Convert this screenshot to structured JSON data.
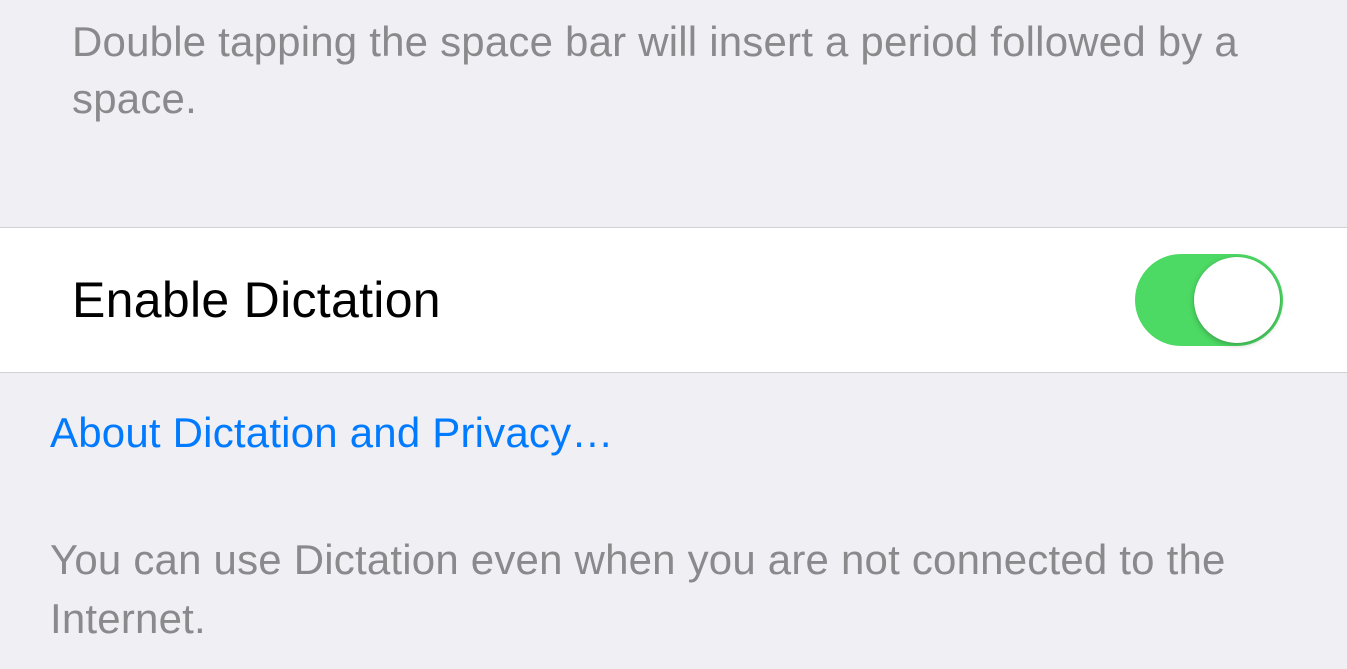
{
  "colors": {
    "background": "#EFEFF4",
    "footerText": "#8A8A8D",
    "rowBackground": "#FFFFFF",
    "separator": "#D1D1D5",
    "label": "#000000",
    "toggleOn": "#4CD964",
    "link": "#007AFF"
  },
  "sections": {
    "previousFooter": "Double tapping the space bar will insert a period followed by a space.",
    "dictation": {
      "label": "Enable Dictation",
      "enabled": true,
      "privacyLink": "About Dictation and Privacy…",
      "description": "You can use Dictation even when you are not connected to the Internet."
    }
  }
}
